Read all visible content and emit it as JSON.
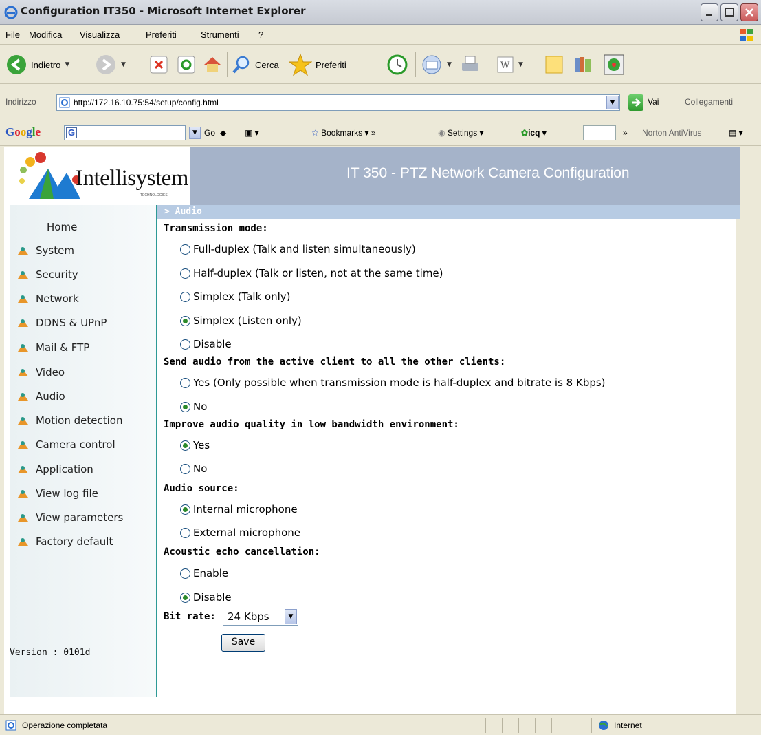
{
  "window": {
    "title": "Configuration IT350 - Microsoft Internet Explorer"
  },
  "menu": [
    "File",
    "Modifica",
    "Visualizza",
    "Preferiti",
    "Strumenti",
    "?"
  ],
  "toolbar": {
    "back_label": "Indietro",
    "search_label": "Cerca",
    "favorites_label": "Preferiti"
  },
  "address": {
    "label": "Indirizzo",
    "url": "http://172.16.10.75:54/setup/config.html",
    "go_label": "Vai",
    "links_label": "Collegamenti"
  },
  "googlebar": {
    "logo": "Google",
    "go": "Go",
    "bookmarks": "Bookmarks",
    "settings": "Settings",
    "icq": "icq",
    "norton": "Norton AntiVirus"
  },
  "banner": {
    "brand": "Intellisystem",
    "brand_sub": "TECHNOLOGIES",
    "title": "IT 350 - PTZ Network Camera Configuration"
  },
  "sidebar": {
    "items": [
      {
        "label": "Home"
      },
      {
        "label": "System"
      },
      {
        "label": "Security"
      },
      {
        "label": "Network"
      },
      {
        "label": "DDNS & UPnP"
      },
      {
        "label": "Mail & FTP"
      },
      {
        "label": "Video"
      },
      {
        "label": "Audio"
      },
      {
        "label": "Motion detection"
      },
      {
        "label": "Camera control"
      },
      {
        "label": "Application"
      },
      {
        "label": "View log file"
      },
      {
        "label": "View parameters"
      },
      {
        "label": "Factory default"
      }
    ],
    "version": "Version : 0101d"
  },
  "section": {
    "title": "> Audio"
  },
  "form": {
    "transmission": {
      "heading": "Transmission mode:",
      "options": [
        {
          "label": "Full-duplex (Talk and listen simultaneously)",
          "checked": false
        },
        {
          "label": "Half-duplex (Talk or listen, not at the same time)",
          "checked": false
        },
        {
          "label": "Simplex (Talk only)",
          "checked": false
        },
        {
          "label": "Simplex (Listen only)",
          "checked": true
        },
        {
          "label": "Disable",
          "checked": false
        }
      ]
    },
    "send_audio": {
      "heading": "Send audio from the active client to all the other clients:",
      "options": [
        {
          "label": "Yes (Only possible when transmission mode is half-duplex and bitrate is 8 Kbps)",
          "checked": false
        },
        {
          "label": "No",
          "checked": true
        }
      ]
    },
    "improve": {
      "heading": "Improve audio quality in low bandwidth environment:",
      "options": [
        {
          "label": "Yes",
          "checked": true
        },
        {
          "label": "No",
          "checked": false
        }
      ]
    },
    "source": {
      "heading": "Audio source:",
      "options": [
        {
          "label": "Internal microphone",
          "checked": true
        },
        {
          "label": "External microphone",
          "checked": false
        }
      ]
    },
    "echo": {
      "heading": "Acoustic echo cancellation:",
      "options": [
        {
          "label": "Enable",
          "checked": false
        },
        {
          "label": "Disable",
          "checked": true
        }
      ]
    },
    "bitrate": {
      "label": "Bit rate:",
      "value": "24 Kbps"
    },
    "save_label": "Save"
  },
  "status": {
    "text": "Operazione completata",
    "zone": "Internet"
  },
  "colors": {
    "banner": "#a5b3c9",
    "section_bar": "#b7cbe3",
    "sidebar_border": "#2e9a96"
  }
}
